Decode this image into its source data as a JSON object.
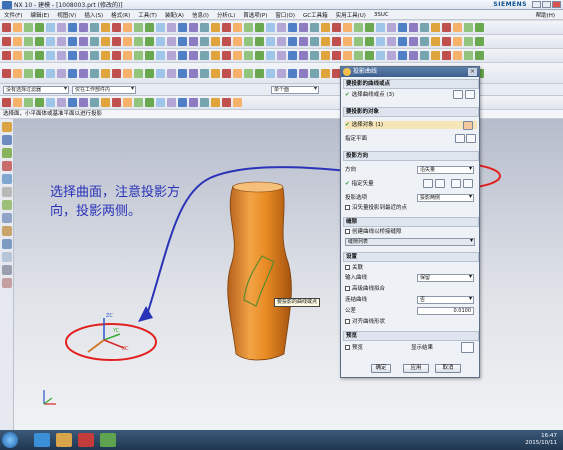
{
  "window": {
    "app": "NX 10 - 建模 - [1008003.prt (修改的)]",
    "brand": "SIEMENS"
  },
  "menu": {
    "items": [
      "文件(F)",
      "编辑(E)",
      "视图(V)",
      "插入(S)",
      "格式(R)",
      "工具(T)",
      "装配(A)",
      "信息(I)",
      "分析(L)",
      "首选项(P)",
      "窗口(O)",
      "GC工具箱",
      "实用工具(U)",
      "3SUC"
    ],
    "help": "帮助(H)"
  },
  "filter": {
    "type_filter": "没有选择过滤器",
    "assembly_filter": "仅在工作部件内",
    "snap": "单个面"
  },
  "status_prompt": "选择面，小平面体或基准平面以进行投影",
  "annotation": {
    "line1": "选择曲面，注意投影方",
    "line2": "向，投影两侧。"
  },
  "tooltip": "要投影的曲线或点",
  "dialog": {
    "title": "投影曲线",
    "sec_curves": "要投影的曲线或点",
    "select_curve": "选择曲线或点 (3)",
    "sec_object": "要投影的对象",
    "select_object": "选择对象 (1)",
    "specify_plane": "指定平面",
    "sec_direction": "投影方向",
    "direction_label": "方向",
    "direction_value": "沿矢量",
    "specify_vector": "指定矢量",
    "projection_option_label": "投影选项",
    "projection_option_value": "投影两侧",
    "along_vector_check": "沿矢量投影到最近的点",
    "sec_gap": "缝隙",
    "create_bridge": "创建曲线以桥接缝隙",
    "gap_list": "缝隙列表",
    "sec_settings": "设置",
    "associative": "关联",
    "input_curve_label": "输入曲线",
    "input_curve_value": "保留",
    "high_level_fit": "高级曲线拟合",
    "join_curve_label": "连结曲线",
    "join_curve_value": "否",
    "tolerance_label": "公差",
    "tolerance_value": "0.0100",
    "align_curve_shape": "对齐曲线形状",
    "sec_preview": "预览",
    "preview": "预览",
    "show_result": "显示结果",
    "ok": "确定",
    "apply": "应用",
    "cancel": "取消"
  },
  "triad": {
    "zc": "ZC",
    "yc": "YC",
    "xc": "XC"
  },
  "taskbar": {
    "time": "16:47",
    "date": "2015/10/11"
  },
  "colors": {
    "part": "#e3902a",
    "annotation": "#2a33b8",
    "circle": "#e32020",
    "titlebar": "#3d5f8d"
  }
}
